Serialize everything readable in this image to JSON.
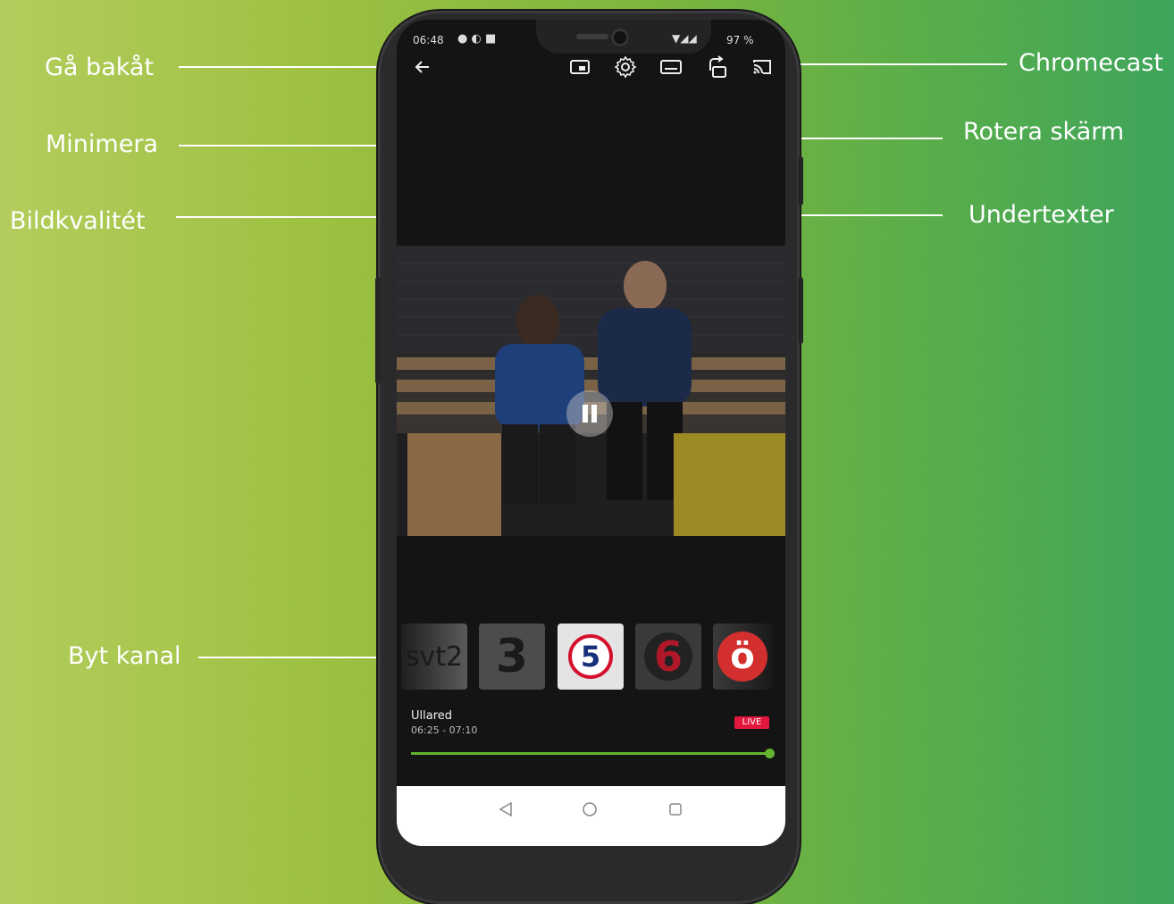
{
  "callouts": {
    "back": "Gå bakåt",
    "minimize": "Minimera",
    "quality": "Bildkvalitét",
    "change_channel": "Byt kanal",
    "chromecast": "Chromecast",
    "rotate": "Rotera skärm",
    "subtitles": "Undertexter"
  },
  "status_bar": {
    "time": "06:48",
    "battery": "97 %"
  },
  "toolbar_icons": [
    "back-arrow-icon",
    "minimize-icon",
    "settings-gear-icon",
    "subtitles-icon",
    "rotate-screen-icon",
    "chromecast-icon"
  ],
  "channels": [
    {
      "name": "svt2",
      "label": "svt2"
    },
    {
      "name": "tv3",
      "label": "3"
    },
    {
      "name": "kanal5",
      "label": "5"
    },
    {
      "name": "tv6",
      "label": "6"
    },
    {
      "name": "sjuan",
      "label": "ö"
    }
  ],
  "program": {
    "title": "Ullared",
    "time": "06:25 - 07:10",
    "live_label": "LIVE",
    "progress": 1.0
  },
  "colors": {
    "accent_green": "#64b32f",
    "live_red": "#e2173d"
  }
}
